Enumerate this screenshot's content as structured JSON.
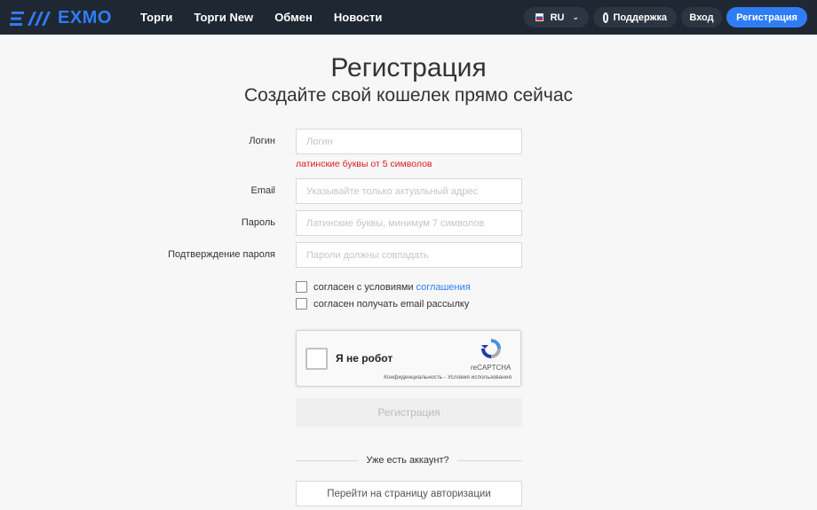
{
  "header": {
    "logo_text": "EXMO",
    "nav": [
      "Торги",
      "Торги New",
      "Обмен",
      "Новости"
    ],
    "lang": "RU",
    "support": "Поддержка",
    "login": "Вход",
    "register": "Регистрация",
    "colors": {
      "bg": "#1f2733",
      "accent": "#2f7df6"
    }
  },
  "page": {
    "title": "Регистрация",
    "subtitle": "Создайте свой кошелек прямо сейчас"
  },
  "form": {
    "login_label": "Логин",
    "login_placeholder": "Логин",
    "login_hint": "латинские буквы от 5 символов",
    "email_label": "Email",
    "email_placeholder": "Указывайте только актуальный адрес",
    "password_label": "Пароль",
    "password_placeholder": "Латинские буквы, минимум 7 символов",
    "confirm_label": "Подтверждение пароля",
    "confirm_placeholder": "Пароли должны совпадать",
    "terms_text": "согласен с условиями",
    "terms_link": "соглашения",
    "newsletter_text": "согласен получать email рассылку",
    "submit": "Регистрация",
    "have_account": "Уже есть аккаунт?",
    "goto_login": "Перейти на страницу авторизации"
  },
  "captcha": {
    "label": "Я не робот",
    "brand": "reCAPTCHA",
    "links": "Конфиденциальность - Условия использования"
  }
}
